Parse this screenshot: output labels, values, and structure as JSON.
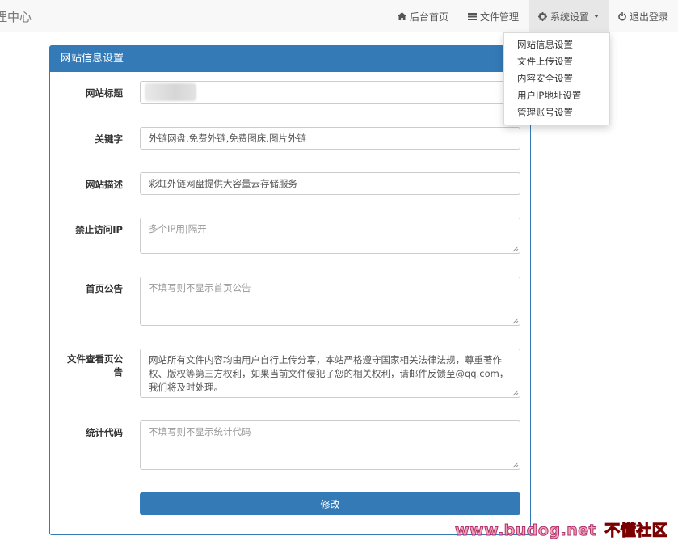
{
  "navbar": {
    "brand": "理中心",
    "items": [
      {
        "icon": "home-icon",
        "label": "后台首页"
      },
      {
        "icon": "list-icon",
        "label": "文件管理"
      },
      {
        "icon": "gear-icon",
        "label": "系统设置"
      },
      {
        "icon": "power-icon",
        "label": "退出登录"
      }
    ]
  },
  "dropdown": {
    "items": [
      "网站信息设置",
      "文件上传设置",
      "内容安全设置",
      "用户IP地址设置",
      "管理账号设置"
    ]
  },
  "panel": {
    "title": "网站信息设置",
    "fields": [
      {
        "label": "网站标题",
        "value": "",
        "placeholder": ""
      },
      {
        "label": "关键字",
        "value": "外链网盘,免费外链,免费图床,图片外链",
        "placeholder": ""
      },
      {
        "label": "网站描述",
        "value": "彩虹外链网盘提供大容量云存储服务",
        "placeholder": ""
      },
      {
        "label": "禁止访问IP",
        "value": "",
        "placeholder": "多个IP用|隔开"
      },
      {
        "label": "首页公告",
        "value": "",
        "placeholder": "不填写则不显示首页公告"
      },
      {
        "label": "文件查看页公告",
        "value": "网站所有文件内容均由用户自行上传分享，本站严格遵守国家相关法律法规，尊重著作权、版权等第三方权利，如果当前文件侵犯了您的相关权利，请邮件反馈至@qq.com，我们将及时处理。",
        "placeholder": ""
      },
      {
        "label": "统计代码",
        "value": "",
        "placeholder": "不填写则不显示统计代码"
      }
    ],
    "submit_label": "修改"
  },
  "watermark": {
    "site": "www.budog.net",
    "name": "不懂社区"
  },
  "colors": {
    "primary": "#337ab7",
    "navbar_bg": "#f8f8f8",
    "active_nav_bg": "#e7e7e7"
  }
}
